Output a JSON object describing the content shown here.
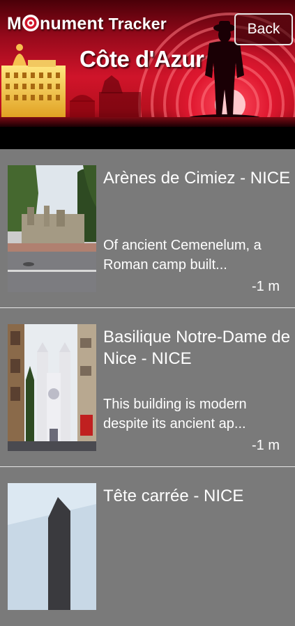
{
  "header": {
    "app_title_word1": "Monument",
    "app_title_word2": "Tracker",
    "region": "Côte d'Azur",
    "back_label": "Back",
    "accent_color": "#d0142a"
  },
  "monuments": [
    {
      "title": "Arènes de Cimiez - NICE",
      "description": "Of ancient Cemenelum, a Roman camp built...",
      "distance": "-1 m"
    },
    {
      "title": "Basilique Notre-Dame de Nice - NICE",
      "description": "This building is modern despite its ancient ap...",
      "distance": "-1 m"
    },
    {
      "title": "Tête carrée - NICE",
      "description": "",
      "distance": ""
    }
  ]
}
